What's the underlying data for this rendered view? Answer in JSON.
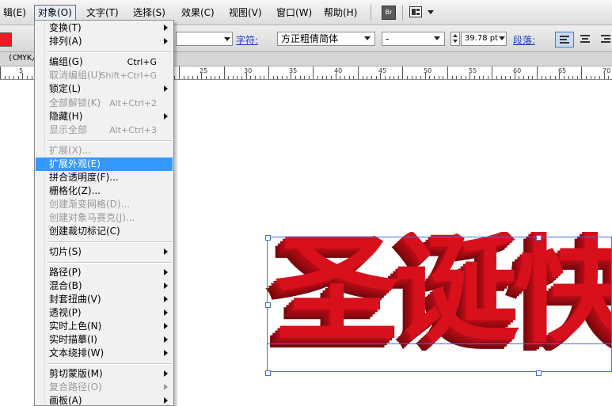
{
  "menubar": {
    "items": [
      "辑(E)",
      "对象(O)",
      "文字(T)",
      "选择(S)",
      "效果(C)",
      "视图(V)",
      "窗口(W)",
      "帮助(H)"
    ],
    "bridge_icon": "Br"
  },
  "controlbar": {
    "char_label": "字符:",
    "font_family": "方正粗倩简体",
    "font_style": "-",
    "font_size": "39.78 pt",
    "para_label": "段落:",
    "fill_color": "#ee1c25"
  },
  "doc_tab": {
    "label": "(CMYK/"
  },
  "ruler": {
    "labels": [
      "5",
      "25",
      "30",
      "35",
      "40",
      "45",
      "50",
      "55",
      "60",
      "65",
      "70"
    ]
  },
  "artwork": {
    "text": "圣诞快",
    "color": "#d8101c"
  },
  "object_menu": {
    "items": [
      {
        "label": "变换(T)",
        "shortcut": "",
        "submenu": true,
        "disabled": false
      },
      {
        "label": "排列(A)",
        "shortcut": "",
        "submenu": true,
        "disabled": false
      },
      {
        "label": "编组(G)",
        "shortcut": "Ctrl+G",
        "submenu": false,
        "disabled": false
      },
      {
        "label": "取消编组(U)",
        "shortcut": "Shift+Ctrl+G",
        "submenu": false,
        "disabled": true
      },
      {
        "label": "锁定(L)",
        "shortcut": "",
        "submenu": true,
        "disabled": false
      },
      {
        "label": "全部解锁(K)",
        "shortcut": "Alt+Ctrl+2",
        "submenu": false,
        "disabled": true
      },
      {
        "label": "隐藏(H)",
        "shortcut": "",
        "submenu": true,
        "disabled": false
      },
      {
        "label": "显示全部",
        "shortcut": "Alt+Ctrl+3",
        "submenu": false,
        "disabled": true
      },
      {
        "label": "扩展(X)...",
        "shortcut": "",
        "submenu": false,
        "disabled": true
      },
      {
        "label": "扩展外观(E)",
        "shortcut": "",
        "submenu": false,
        "disabled": false,
        "highlighted": true
      },
      {
        "label": "拼合透明度(F)...",
        "shortcut": "",
        "submenu": false,
        "disabled": false
      },
      {
        "label": "栅格化(Z)...",
        "shortcut": "",
        "submenu": false,
        "disabled": false
      },
      {
        "label": "创建渐变网格(D)...",
        "shortcut": "",
        "submenu": false,
        "disabled": true
      },
      {
        "label": "创建对象马赛克(J)...",
        "shortcut": "",
        "submenu": false,
        "disabled": true
      },
      {
        "label": "创建裁切标记(C)",
        "shortcut": "",
        "submenu": false,
        "disabled": false
      },
      {
        "label": "切片(S)",
        "shortcut": "",
        "submenu": true,
        "disabled": false
      },
      {
        "label": "路径(P)",
        "shortcut": "",
        "submenu": true,
        "disabled": false
      },
      {
        "label": "混合(B)",
        "shortcut": "",
        "submenu": true,
        "disabled": false
      },
      {
        "label": "封套扭曲(V)",
        "shortcut": "",
        "submenu": true,
        "disabled": false
      },
      {
        "label": "透视(P)",
        "shortcut": "",
        "submenu": true,
        "disabled": false
      },
      {
        "label": "实时上色(N)",
        "shortcut": "",
        "submenu": true,
        "disabled": false
      },
      {
        "label": "实时描摹(I)",
        "shortcut": "",
        "submenu": true,
        "disabled": false
      },
      {
        "label": "文本绕排(W)",
        "shortcut": "",
        "submenu": true,
        "disabled": false
      },
      {
        "label": "剪切蒙版(M)",
        "shortcut": "",
        "submenu": true,
        "disabled": false
      },
      {
        "label": "复合路径(O)",
        "shortcut": "",
        "submenu": true,
        "disabled": true
      },
      {
        "label": "画板(A)",
        "shortcut": "",
        "submenu": true,
        "disabled": false
      }
    ]
  }
}
